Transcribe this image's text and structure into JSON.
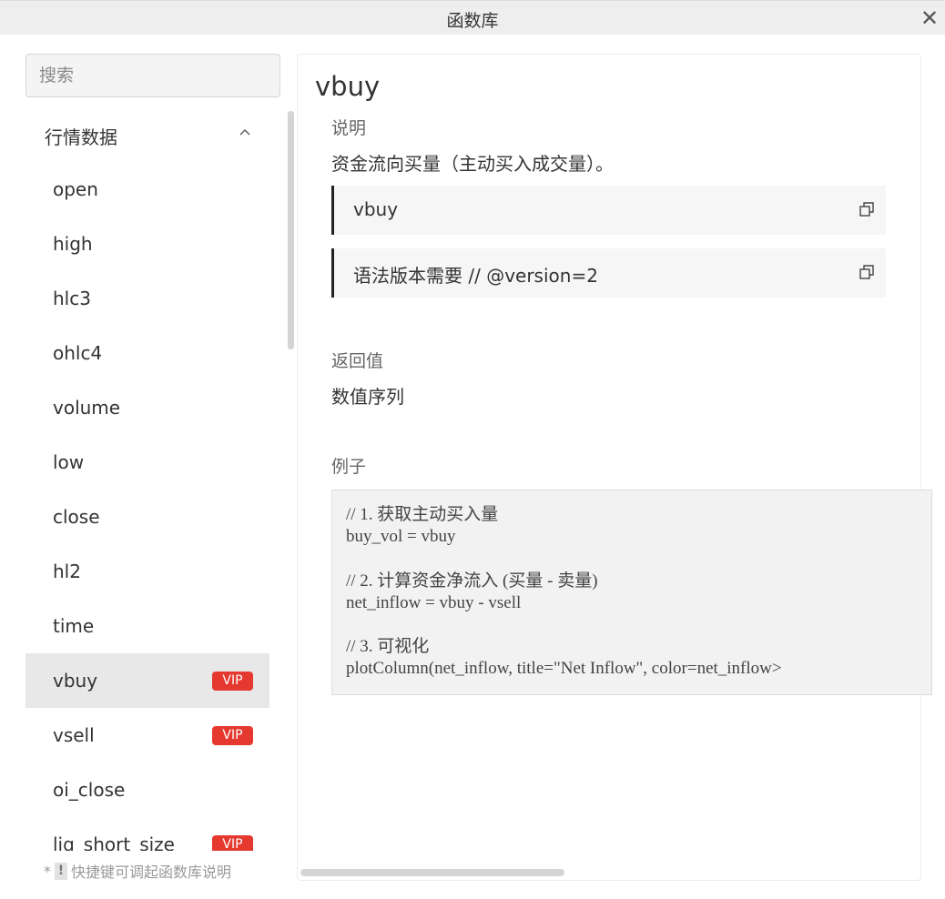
{
  "window": {
    "title": "函数库",
    "close_glyph": "✕"
  },
  "search": {
    "placeholder": "搜索",
    "value": ""
  },
  "sidebar": {
    "group": {
      "label": "行情数据",
      "expanded": true,
      "icon": "chevron-up-icon"
    },
    "items": [
      {
        "label": "open",
        "vip": false
      },
      {
        "label": "high",
        "vip": false
      },
      {
        "label": "hlc3",
        "vip": false
      },
      {
        "label": "ohlc4",
        "vip": false
      },
      {
        "label": "volume",
        "vip": false
      },
      {
        "label": "low",
        "vip": false
      },
      {
        "label": "close",
        "vip": false
      },
      {
        "label": "hl2",
        "vip": false
      },
      {
        "label": "time",
        "vip": false
      },
      {
        "label": "vbuy",
        "vip": true,
        "selected": true
      },
      {
        "label": "vsell",
        "vip": true
      },
      {
        "label": "oi_close",
        "vip": false
      },
      {
        "label": "liq_short_size",
        "vip": true
      }
    ],
    "vip_badge": "VIP"
  },
  "tip": {
    "star": "*",
    "bang": "!",
    "text": "快捷键可调起函数库说明"
  },
  "detail": {
    "function_name": "vbuy",
    "description_label": "说明",
    "description": "资金流向买量（主动买入成交量）。",
    "code_lines": [
      "vbuy",
      "语法版本需要 // @version=2"
    ],
    "return_label": "返回值",
    "return_value": "数值序列",
    "example_label": "例子",
    "example_code": "// 1. 获取主动买入量\nbuy_vol = vbuy\n\n// 2. 计算资金净流入 (买量 - 卖量)\nnet_inflow = vbuy - vsell\n\n// 3. 可视化\nplotColumn(net_inflow, title=\"Net Inflow\", color=net_inflow>"
  },
  "colors": {
    "vip_badge": "#e5382f",
    "selected_row": "#e8e8e8",
    "code_border": "#222222"
  }
}
